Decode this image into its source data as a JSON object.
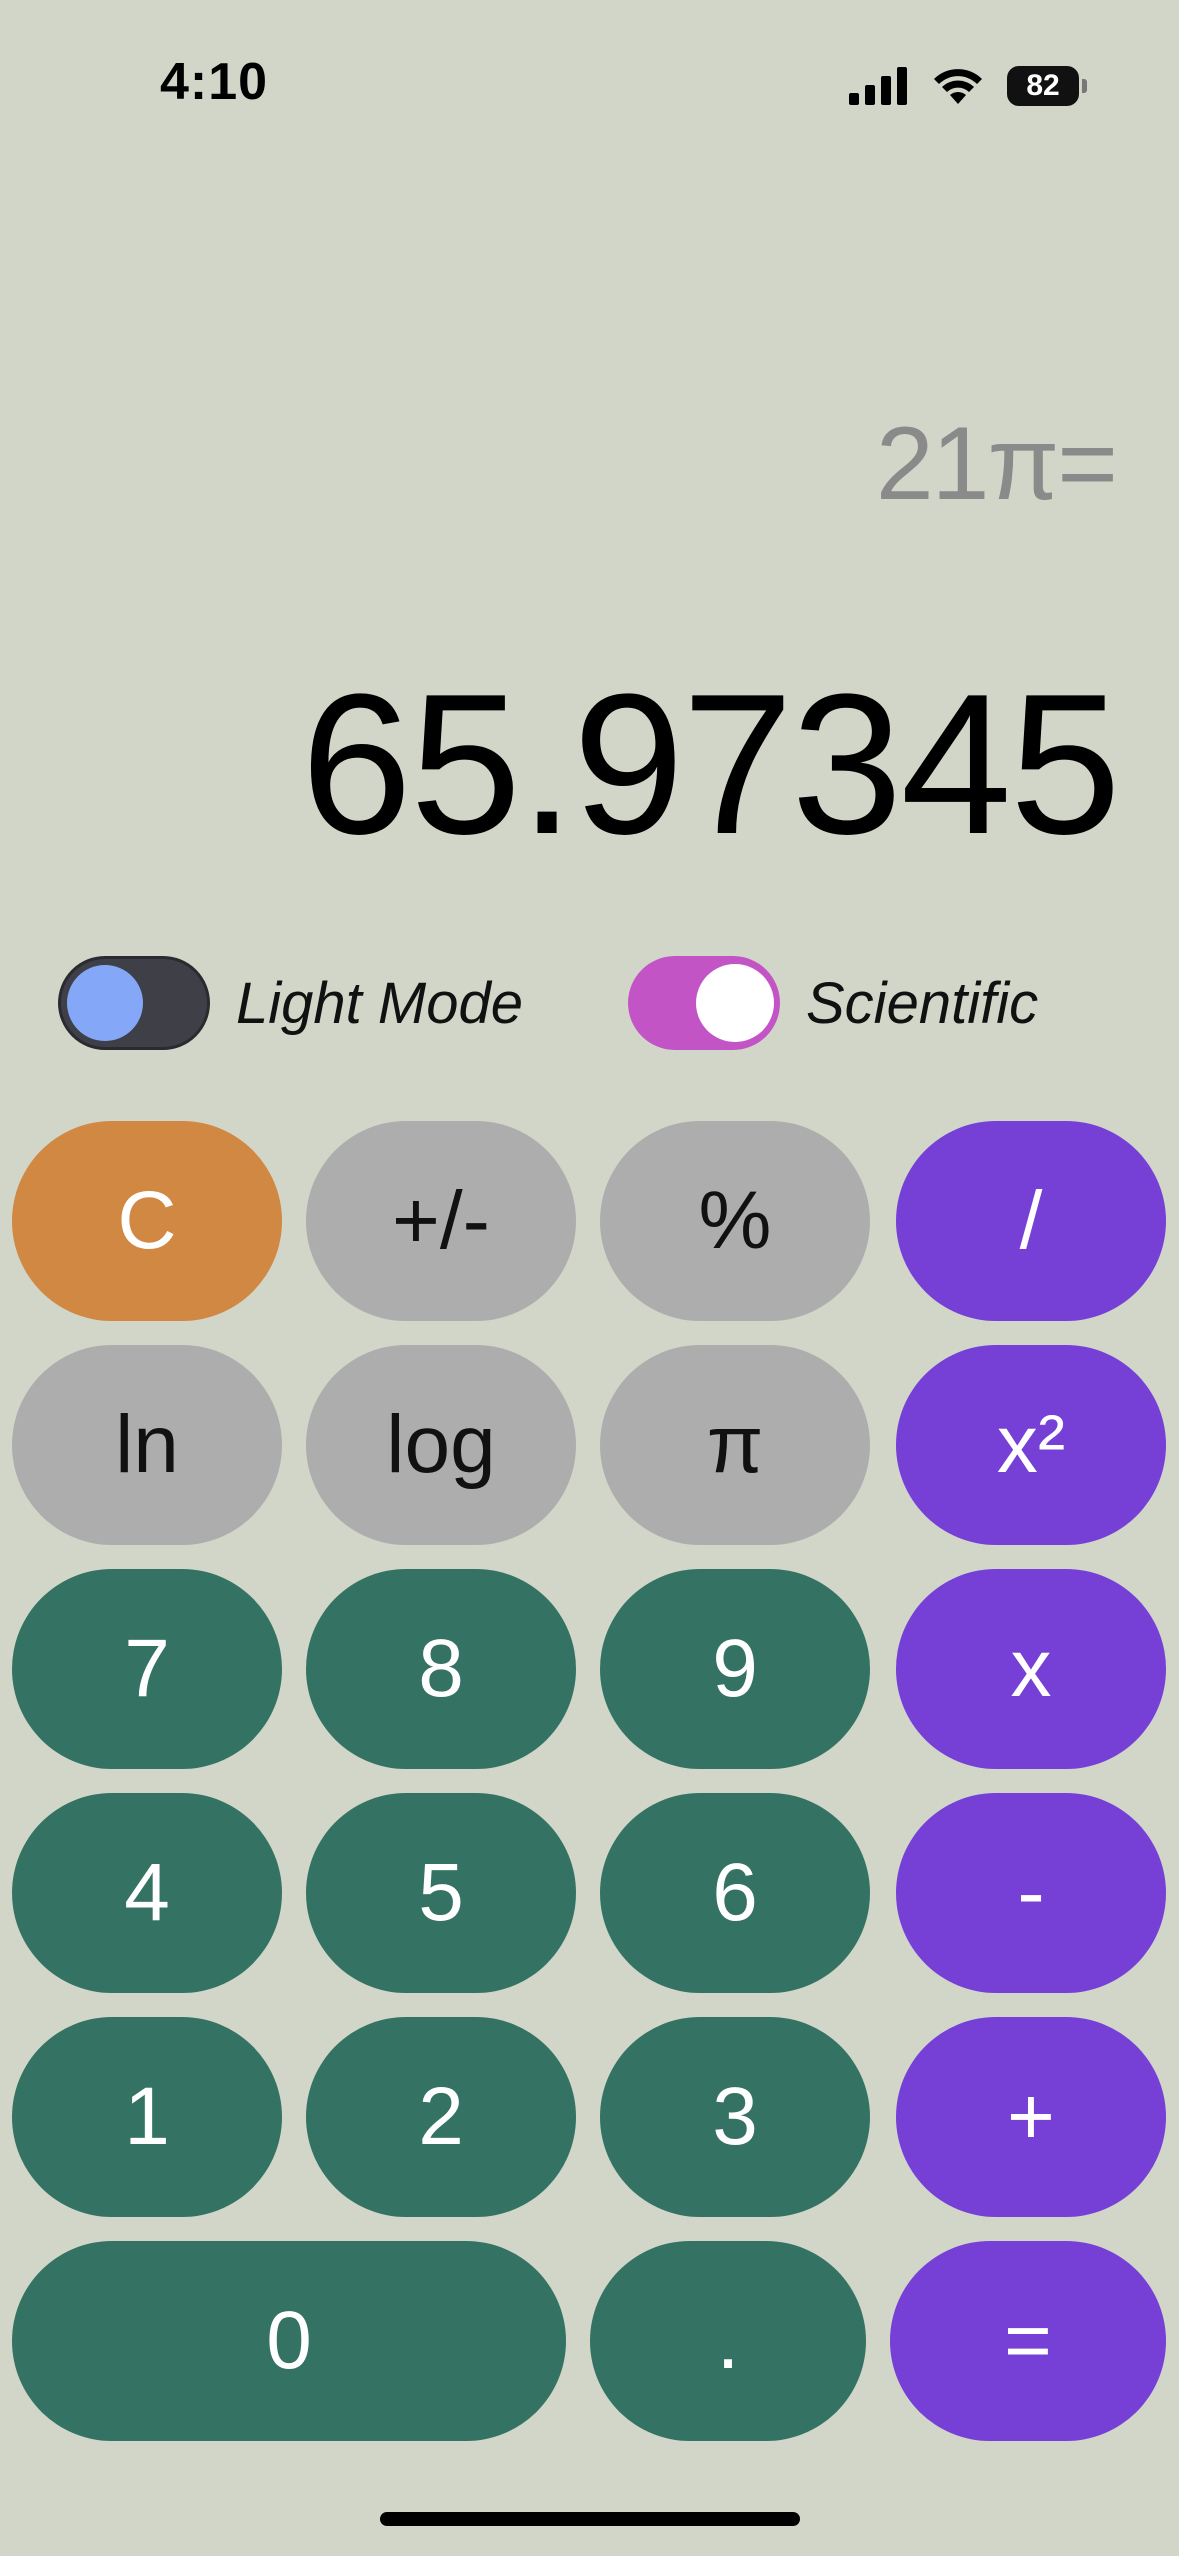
{
  "status_bar": {
    "time": "4:10",
    "battery": "82"
  },
  "display": {
    "expression": "21π=",
    "result": "65.97345"
  },
  "toggles": {
    "light_mode": {
      "label": "Light Mode",
      "on": false
    },
    "scientific": {
      "label": "Scientific",
      "on": true
    }
  },
  "keypad": {
    "clear": "C",
    "sign": "+/-",
    "percent": "%",
    "divide": "/",
    "ln": "ln",
    "log": "log",
    "pi": "π",
    "square": "x²",
    "seven": "7",
    "eight": "8",
    "nine": "9",
    "multiply": "x",
    "four": "4",
    "five": "5",
    "six": "6",
    "minus": "-",
    "one": "1",
    "two": "2",
    "three": "3",
    "plus": "+",
    "zero": "0",
    "decimal": ".",
    "equals": "="
  },
  "colors": {
    "background": "#d1d6c8",
    "clear_key": "#d08843",
    "function_key": "#adadad",
    "operator_key": "#763fd6",
    "digit_key": "#347364",
    "light_mode_knob": "#84a8f7",
    "scientific_toggle": "#c254c6"
  }
}
